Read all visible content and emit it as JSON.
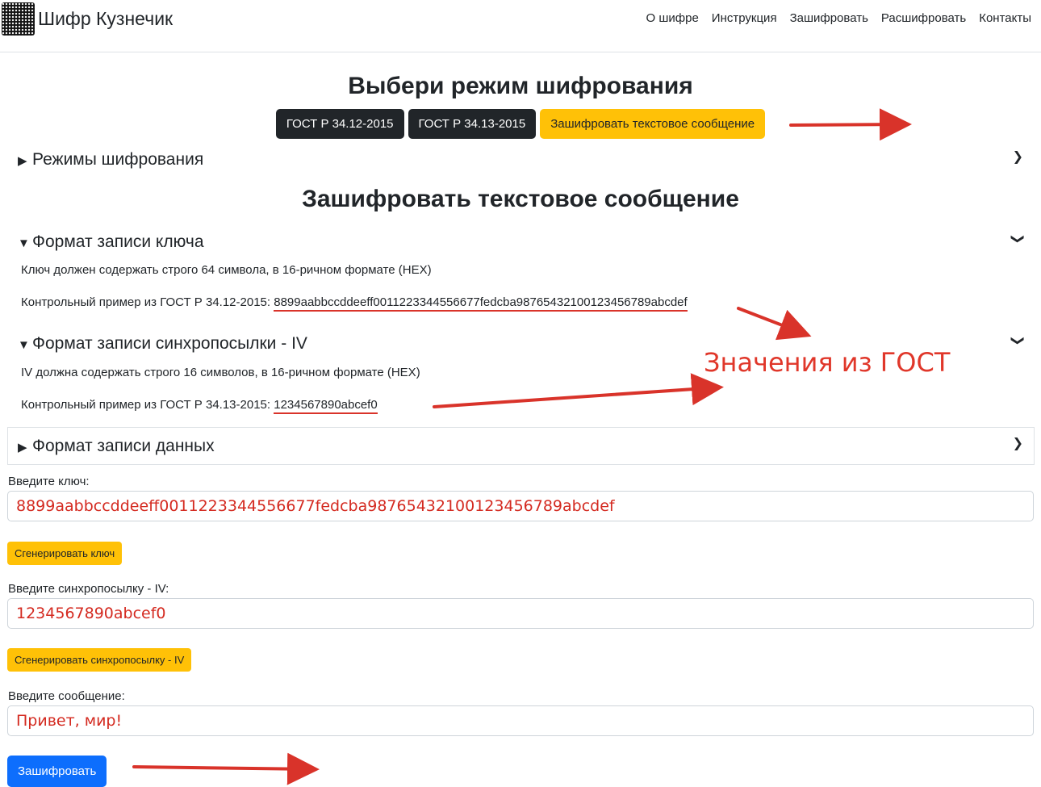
{
  "app": {
    "brand": "Шифр Кузнечик",
    "logo_icon": "noise-logo-icon"
  },
  "nav": {
    "items": [
      "О шифре",
      "Инструкция",
      "Зашифровать",
      "Расшифровать",
      "Контакты"
    ]
  },
  "modes": {
    "title": "Выбери режим шифрования",
    "buttons": [
      "ГОСТ Р 34.12-2015",
      "ГОСТ Р 34.13-2015",
      "Зашифровать текстовое сообщение"
    ],
    "active": "Зашифровать текстовое сообщение",
    "details_label": "Режимы шифрования"
  },
  "section": {
    "title": "Зашифровать текстовое сообщение",
    "key_format": {
      "label": "Формат записи ключа",
      "desc": "Ключ должен содержать строго 64 символа, в 16-ричном формате (HEX)",
      "example_prefix": "Контрольный пример из ГОСТ Р 34.12-2015:",
      "example_value": "8899aabbccddeeff0011223344556677fedcba98765432100123456789abcdef"
    },
    "iv_format": {
      "label": "Формат записи синхропосылки - IV",
      "desc": "IV должна содержать строго 16 символов, в 16-ричном формате (HEX)",
      "example_prefix": "Контрольный пример из ГОСТ Р 34.13-2015:",
      "example_value": "1234567890abcef0"
    },
    "data_format": {
      "label": "Формат записи данных"
    }
  },
  "form": {
    "key_label": "Введите ключ:",
    "key_value": "8899aabbccddeeff0011223344556677fedcba98765432100123456789abcdef",
    "gen_key": "Сгенерировать ключ",
    "iv_label": "Введите синхропосылку - IV:",
    "iv_value": "1234567890abcef0",
    "gen_iv": "Сгенерировать синхропосылку - IV",
    "msg_label": "Введите сообщение:",
    "msg_value": "Привет, мир!",
    "submit": "Зашифровать"
  },
  "annotation": {
    "text": "Значения из ГОСТ",
    "color": "#e0372a"
  },
  "colors": {
    "warning": "#ffc107",
    "dark": "#212529",
    "primary": "#0d6efd",
    "annotation_red": "#d9332a"
  }
}
